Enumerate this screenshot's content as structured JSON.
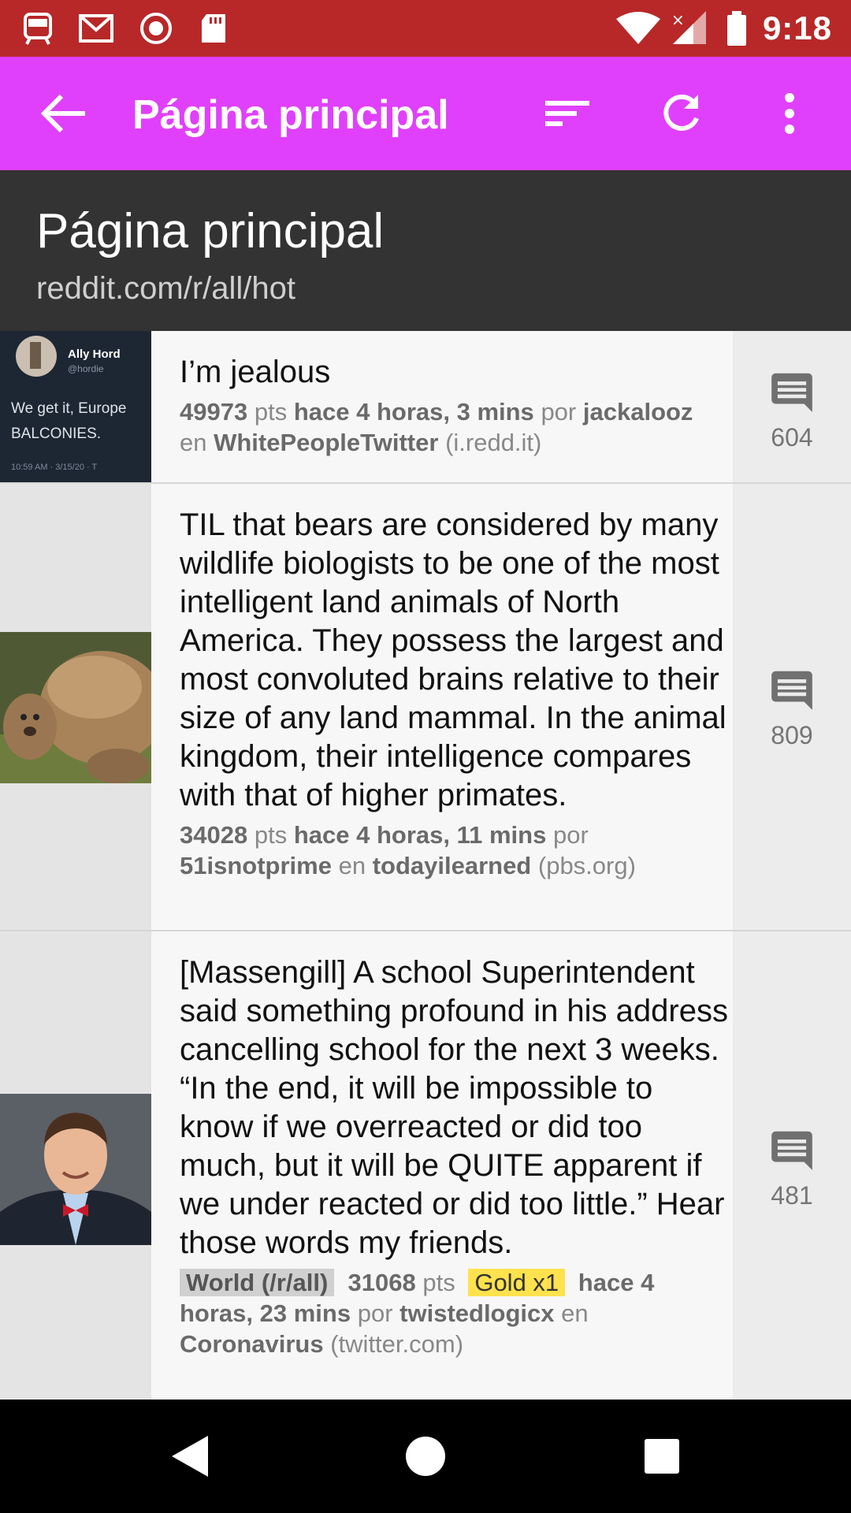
{
  "status_bar": {
    "time": "9:18",
    "left_icons": [
      "train-icon",
      "gmail-icon",
      "record-icon",
      "sd-card-icon"
    ],
    "right_icons": [
      "wifi-icon",
      "signal-icon",
      "battery-icon"
    ],
    "color": "#b82828"
  },
  "app_bar": {
    "title": "Página principal",
    "color": "#e040fb"
  },
  "header": {
    "title": "Página principal",
    "subtitle": "reddit.com/r/all/hot"
  },
  "posts": [
    {
      "title": "I’m jealous",
      "points": "49973",
      "pts_label": "pts",
      "time": "hace 4 horas, 3 mins",
      "by": "por",
      "author": "jackalooz",
      "in": "en",
      "subreddit": "WhitePeopleTwitter",
      "domain": "(i.redd.it)",
      "comments": "604",
      "thumb": {
        "name": "Ally Hord",
        "handle": "@hordie",
        "line1": "We get it, Europe",
        "line2": "BALCONIES.",
        "stamp": "10:59 AM · 3/15/20 · T"
      }
    },
    {
      "title": "TIL that bears are considered by many wildlife biologists to be one of the most intelligent land animals of North America. They possess the largest and most convoluted brains relative to their size of any land mammal. In the animal kingdom, their intelligence compares with that of higher primates.",
      "points": "34028",
      "pts_label": "pts",
      "time": "hace 4 horas, 11 mins",
      "by": "por",
      "author": "51isnotprime",
      "in": "en",
      "subreddit": "todayilearned",
      "domain": "(pbs.org)",
      "comments": "809"
    },
    {
      "title": "[Massengill] A school Superintendent said something profound in his address cancelling school for the next 3 weeks. “In the end, it will be impossible to know if we overreacted or did too much, but it will be QUITE apparent if we under reacted or did too little.” Hear those words my friends.",
      "flair": "World (/r/all)",
      "points": "31068",
      "pts_label": "pts",
      "gold": "Gold x1",
      "time": "hace 4 horas, 23 mins",
      "by": "por",
      "author": "twistedlogicx",
      "in": "en",
      "subreddit": "Coronavirus",
      "domain": "(twitter.com)",
      "comments": "481"
    }
  ]
}
